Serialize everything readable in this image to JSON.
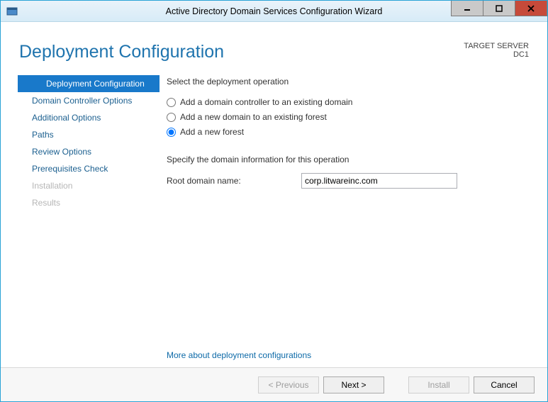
{
  "window": {
    "title": "Active Directory Domain Services Configuration Wizard"
  },
  "header": {
    "page_title": "Deployment Configuration",
    "target_server_label": "TARGET SERVER",
    "target_server_name": "DC1"
  },
  "sidebar": {
    "steps": [
      {
        "label": "Deployment Configuration",
        "state": "active"
      },
      {
        "label": "Domain Controller Options",
        "state": "normal"
      },
      {
        "label": "Additional Options",
        "state": "normal"
      },
      {
        "label": "Paths",
        "state": "normal"
      },
      {
        "label": "Review Options",
        "state": "normal"
      },
      {
        "label": "Prerequisites Check",
        "state": "normal"
      },
      {
        "label": "Installation",
        "state": "disabled"
      },
      {
        "label": "Results",
        "state": "disabled"
      }
    ]
  },
  "main": {
    "select_op_label": "Select the deployment operation",
    "radios": [
      {
        "label": "Add a domain controller to an existing domain",
        "checked": false
      },
      {
        "label": "Add a new domain to an existing forest",
        "checked": false
      },
      {
        "label": "Add a new forest",
        "checked": true
      }
    ],
    "specify_label": "Specify the domain information for this operation",
    "root_domain_label": "Root domain name:",
    "root_domain_value": "corp.litwareinc.com",
    "more_link": "More about deployment configurations"
  },
  "buttons": {
    "previous": "< Previous",
    "next": "Next >",
    "install": "Install",
    "cancel": "Cancel"
  }
}
